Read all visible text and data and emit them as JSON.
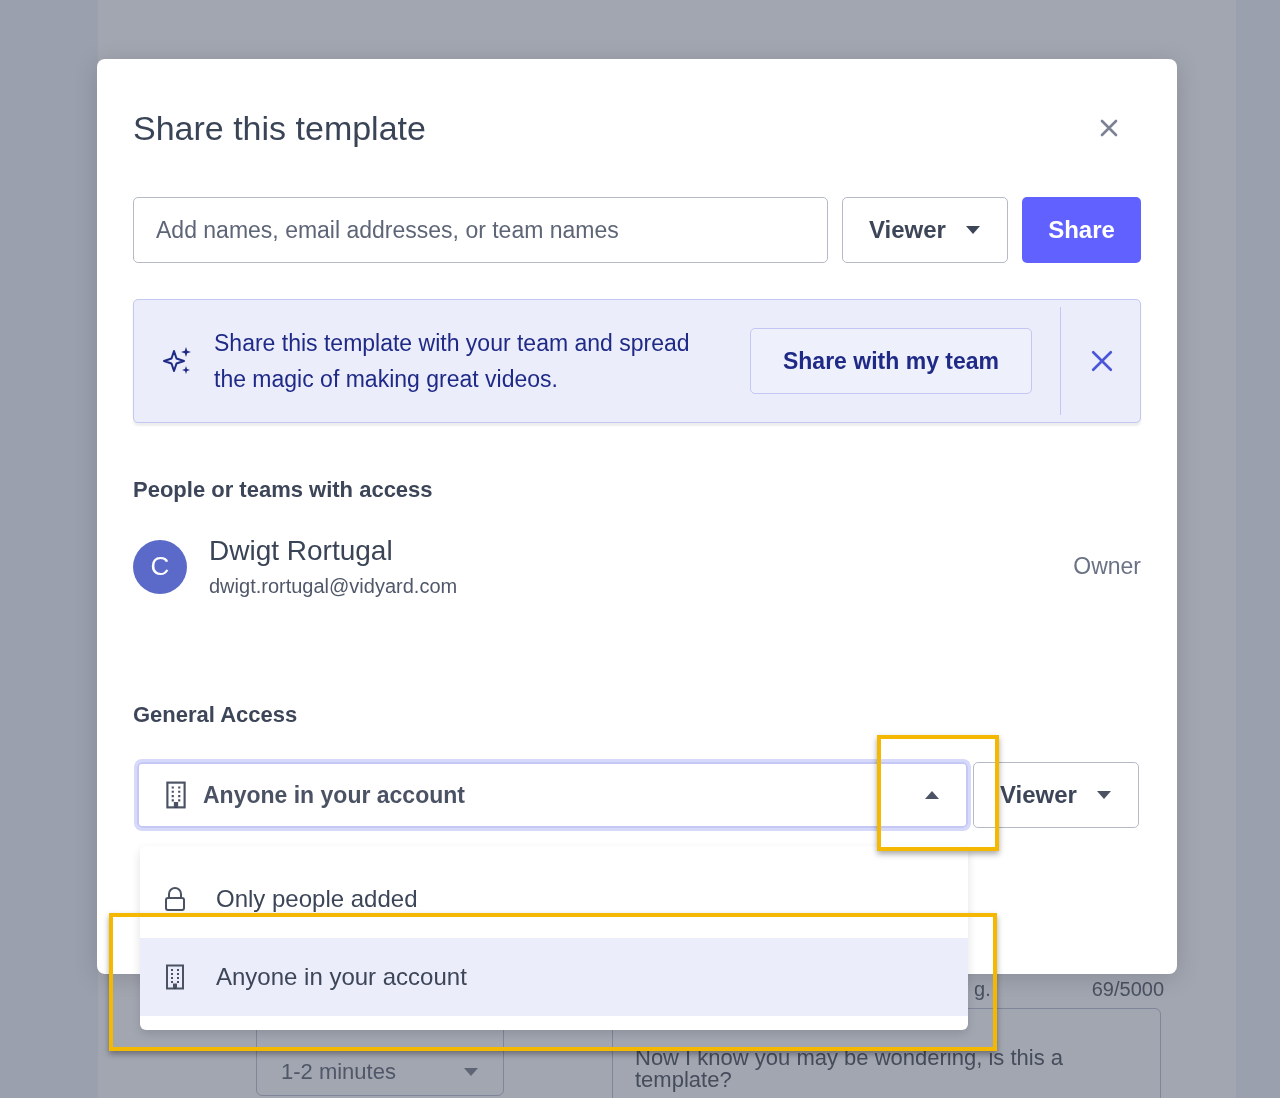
{
  "background": {
    "hint": "g.",
    "counter": "69/5000",
    "duration": "1-2 minutes",
    "script_text": "Now I know you may be wondering, is this a template?"
  },
  "dialog": {
    "title": "Share this template"
  },
  "invite": {
    "placeholder": "Add names, email addresses, or team names",
    "role": "Viewer",
    "button": "Share"
  },
  "banner": {
    "message": "Share this template with your team and spread the magic of making great videos.",
    "button": "Share with my team"
  },
  "access": {
    "heading": "People or teams with access",
    "people": [
      {
        "initial": "C",
        "name": "Dwigt Rortugal",
        "email": "dwigt.rortugal@vidyard.com",
        "role": "Owner"
      }
    ]
  },
  "general_access": {
    "heading": "General Access",
    "value": "Anyone in your account",
    "expanded": true,
    "caret_highlighted": true,
    "role": "Viewer",
    "options": [
      {
        "label": "Only people added",
        "kind": "lock",
        "selected": false,
        "highlighted": false
      },
      {
        "label": "Anyone in your account",
        "kind": "building",
        "selected": true,
        "highlighted": true
      }
    ]
  }
}
